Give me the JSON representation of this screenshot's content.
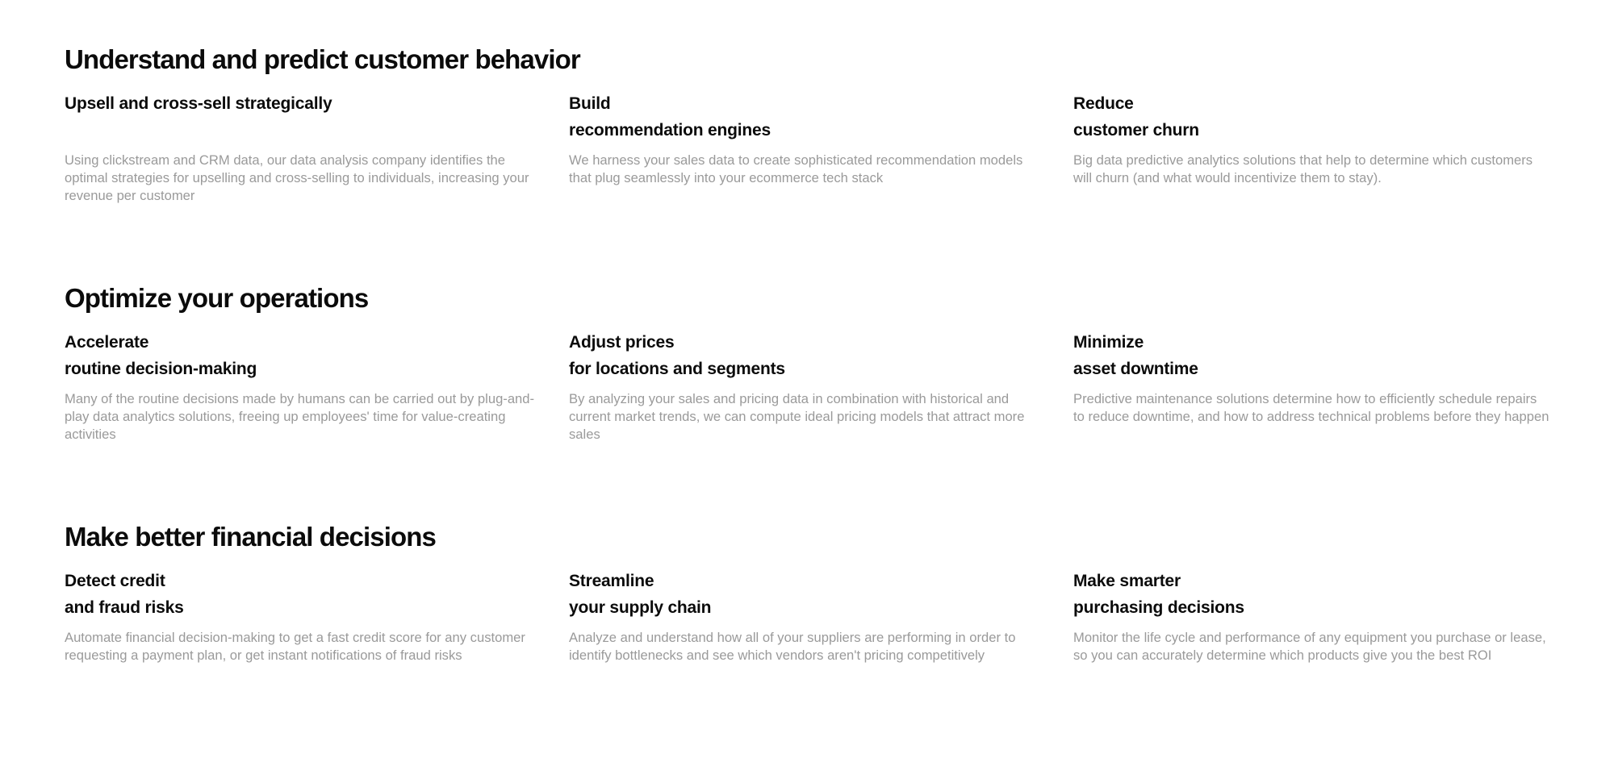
{
  "sections": [
    {
      "title": "Understand and predict customer behavior",
      "cards": [
        {
          "title_line1": "Upsell and cross-sell strategically",
          "title_line2": "",
          "text": "Using clickstream and CRM data, our data analysis company identifies the optimal strategies for upselling and cross-selling to individuals, increasing your revenue per customer"
        },
        {
          "title_line1": "Build",
          "title_line2": "recommendation engines",
          "text": "We harness your sales data to create sophisticated recommendation models that plug seamlessly into your ecommerce tech stack"
        },
        {
          "title_line1": "Reduce",
          "title_line2": "customer churn",
          "text": "Big data predictive analytics solutions that help to determine which customers will churn (and what would incentivize them to stay)."
        }
      ]
    },
    {
      "title": "Optimize your operations",
      "cards": [
        {
          "title_line1": "Accelerate",
          "title_line2": "routine decision-making",
          "text": "Many of the routine decisions made by humans can be carried out by plug-and-play data analytics solutions, freeing up employees' time for value-creating activities"
        },
        {
          "title_line1": "Adjust prices",
          "title_line2": "for locations and segments",
          "text": "By analyzing your sales and pricing data in combination with historical and current market trends, we can compute ideal pricing models that attract more sales"
        },
        {
          "title_line1": "Minimize",
          "title_line2": "asset downtime",
          "text": "Predictive maintenance solutions determine how to efficiently schedule repairs to reduce downtime, and how to address technical problems before they happen"
        }
      ]
    },
    {
      "title": "Make better financial decisions",
      "cards": [
        {
          "title_line1": "Detect credit",
          "title_line2": "and fraud risks",
          "text": "Automate financial decision-making to get a fast credit score for any customer requesting a payment plan, or get instant notifications of fraud risks"
        },
        {
          "title_line1": "Streamline",
          "title_line2": "your supply chain",
          "text": "Analyze and understand how all of your suppliers are performing in order to identify bottlenecks and see which vendors aren't pricing competitively"
        },
        {
          "title_line1": "Make smarter",
          "title_line2": "purchasing decisions",
          "text": "Monitor the life cycle and performance of any equipment you purchase or lease, so you can accurately determine which products give you the best ROI"
        }
      ]
    }
  ]
}
